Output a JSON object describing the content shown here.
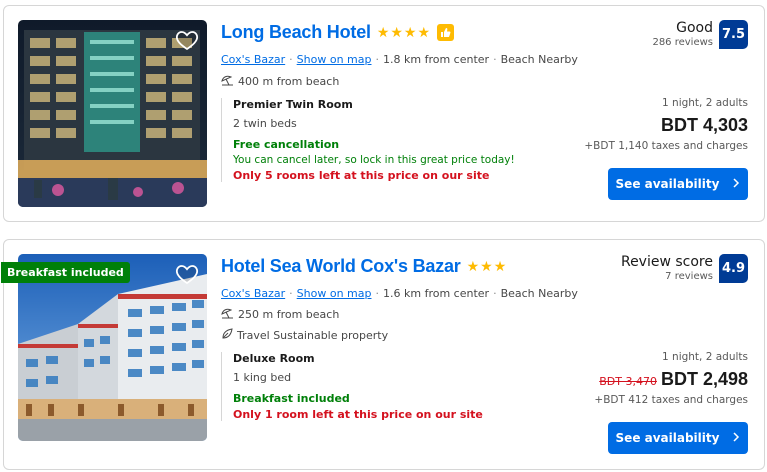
{
  "hotels": [
    {
      "name": "Long Beach Hotel",
      "stars": "★★★★",
      "location": "Cox's Bazar",
      "show_on_map": "Show on map",
      "distance_center": "1.8 km from center",
      "beach_nearby": "Beach Nearby",
      "beach_distance": "400 m from beach",
      "room_name": "Premier Twin Room",
      "beds": "2 twin beds",
      "perk": "Free cancellation",
      "perk_note": "You can cancel later, so lock in this great price today!",
      "scarcity": "Only 5 rooms left at this price on our site",
      "score_label": "Good",
      "reviews": "286 reviews",
      "score": "7.5",
      "nights": "1 night, 2 adults",
      "price": "BDT 4,303",
      "taxes": "+BDT 1,140 taxes and charges",
      "cta": "See availability"
    },
    {
      "badge": "Breakfast included",
      "name": "Hotel Sea World Cox's Bazar",
      "stars": "★★★",
      "location": "Cox's Bazar",
      "show_on_map": "Show on map",
      "distance_center": "1.6 km from center",
      "beach_nearby": "Beach Nearby",
      "beach_distance": "250 m from beach",
      "sustainable": "Travel Sustainable property",
      "room_name": "Deluxe Room",
      "beds": "1 king bed",
      "perk": "Breakfast included",
      "scarcity": "Only 1 room left at this price on our site",
      "score_label": "Review score",
      "reviews": "7 reviews",
      "score": "4.9",
      "nights": "1 night, 2 adults",
      "old_price": "BDT 3,470",
      "price": "BDT 2,498",
      "taxes": "+BDT 412 taxes and charges",
      "cta": "See availability"
    }
  ],
  "colors": {
    "brand_blue": "#006ce4",
    "score_blue": "#003b95",
    "green": "#008009",
    "red": "#d4111e",
    "star": "#febb02"
  }
}
